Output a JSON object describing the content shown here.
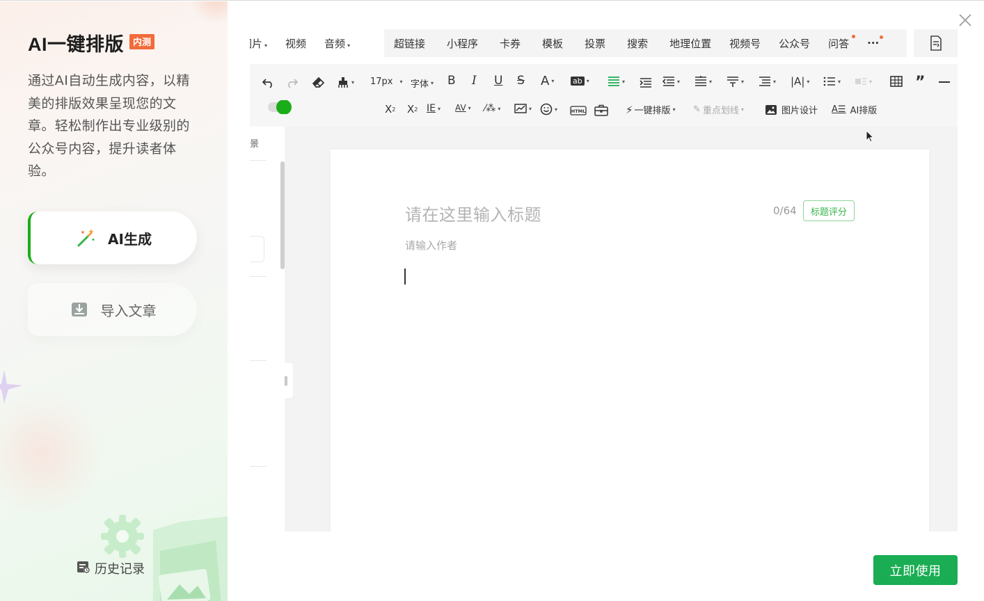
{
  "panel": {
    "title": "AI一键排版",
    "badge": "内测",
    "description": "通过AI自动生成内容，以精美的排版效果呈现您的文章。轻松制作出专业级别的公众号内容，提升读者体验。",
    "ai_generate_label": "AI生成",
    "import_label": "导入文章",
    "history_label": "历史记录"
  },
  "preview": {
    "menu_left": [
      "图片",
      "视频",
      "音频"
    ],
    "menu_main": [
      "超链接",
      "小程序",
      "卡券",
      "模板",
      "投票",
      "搜索",
      "地理位置",
      "视频号",
      "公众号",
      "问答"
    ],
    "more_label": "···",
    "font_size": "17px",
    "font_label": "字体",
    "one_click_label": "一键排版",
    "highlight_label": "重点划线",
    "image_design_label": "图片设计",
    "ai_layout_label": "AI排版",
    "strip_label": "景",
    "editor": {
      "title_placeholder": "请在这里输入标题",
      "title_count": "0/64",
      "score_label": "标题评分",
      "author_placeholder": "请输入作者"
    }
  },
  "footer": {
    "use_now_label": "立即使用"
  },
  "colors": {
    "brand_green": "#1aad53",
    "accent_orange": "#f26b3a",
    "active_bar": "#1aad19"
  },
  "icons": [
    "close-icon",
    "magic-wand-icon",
    "import-icon",
    "history-icon",
    "undo-icon",
    "redo-icon",
    "eraser-icon",
    "format-brush-icon",
    "bold-icon",
    "italic-icon",
    "underline-icon",
    "strikethrough-icon",
    "font-color-icon",
    "background-color-icon",
    "align-icon",
    "table-icon",
    "quote-icon",
    "divider-icon",
    "superscript-icon",
    "subscript-icon",
    "emoji-icon",
    "html-icon",
    "toolbox-icon",
    "image-design-icon",
    "ai-layout-icon"
  ]
}
